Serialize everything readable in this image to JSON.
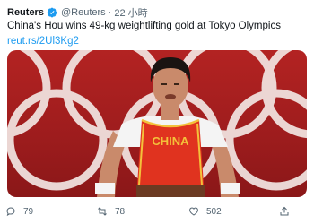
{
  "tweet": {
    "author_name": "Reuters",
    "handle": "@Reuters",
    "separator": "·",
    "time": "22 小時",
    "text": "China's Hou wins 49-kg weightlifting gold at Tokyo Olympics",
    "link": "reut.rs/2Ul3Kg2",
    "image": {
      "jersey_text": "CHINA",
      "colors": {
        "background_red": "#b32322",
        "olympic_rings": "#f2e6e3",
        "jersey_red": "#e0331f",
        "jersey_trim": "#f3c13a"
      }
    }
  },
  "actions": {
    "reply": {
      "icon": "reply-icon",
      "count": "79"
    },
    "retweet": {
      "icon": "retweet-icon",
      "count": "78"
    },
    "like": {
      "icon": "heart-icon",
      "count": "502"
    },
    "share": {
      "icon": "share-icon"
    }
  },
  "colors": {
    "text": "#0f1419",
    "secondary": "#536471",
    "link": "#1d9bf0",
    "verified": "#1d9bf0"
  }
}
